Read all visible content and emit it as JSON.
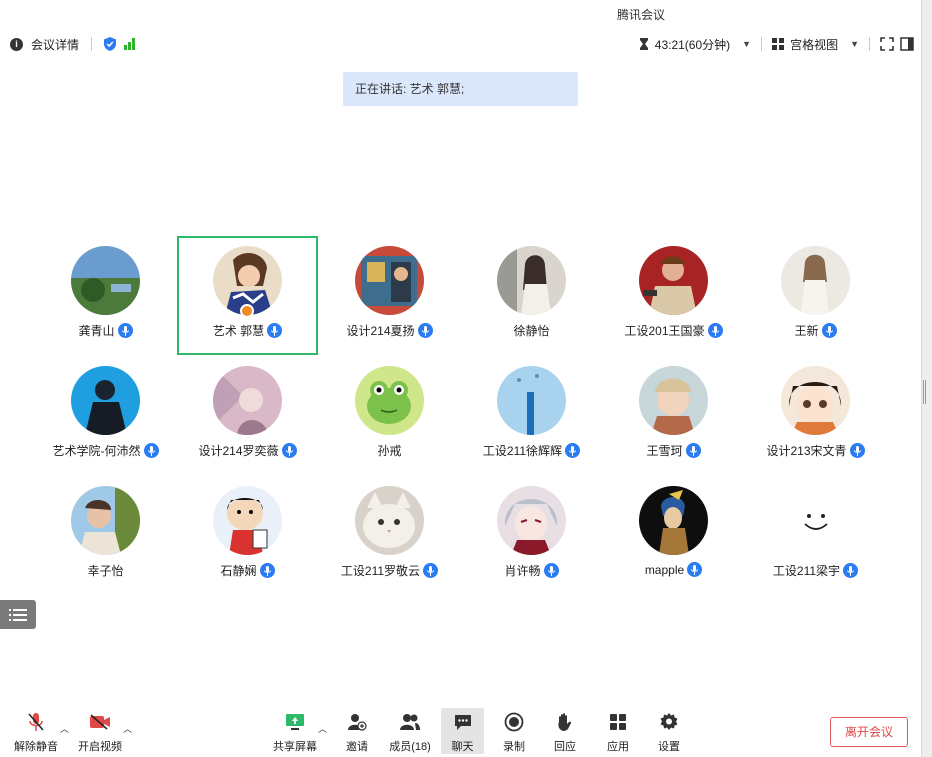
{
  "window": {
    "title": "腾讯会议"
  },
  "toolbar": {
    "meeting_info_label": "会议详情",
    "timer": "43:21(60分钟)",
    "view_label": "宫格视图"
  },
  "speaking": {
    "text": "正在讲话: 艺术 郭慧;"
  },
  "participants": [
    {
      "name": "龚青山",
      "mic": true,
      "active": false,
      "host": false
    },
    {
      "name": "艺术 郭慧",
      "mic": true,
      "active": true,
      "host": true
    },
    {
      "name": "设计214夏扬",
      "mic": true,
      "active": false,
      "host": false
    },
    {
      "name": "徐静怡",
      "mic": false,
      "active": false,
      "host": false
    },
    {
      "name": "工设201王国豪",
      "mic": true,
      "active": false,
      "host": false
    },
    {
      "name": "王新",
      "mic": true,
      "active": false,
      "host": false
    },
    {
      "name": "艺术学院-何沛然",
      "mic": true,
      "active": false,
      "host": false
    },
    {
      "name": "设计214罗奕薇",
      "mic": true,
      "active": false,
      "host": false
    },
    {
      "name": "孙戒",
      "mic": false,
      "active": false,
      "host": false
    },
    {
      "name": "工设211徐辉辉",
      "mic": true,
      "active": false,
      "host": false
    },
    {
      "name": "王雪珂",
      "mic": true,
      "active": false,
      "host": false
    },
    {
      "name": "设计213宋文青",
      "mic": true,
      "active": false,
      "host": false
    },
    {
      "name": "幸子怡",
      "mic": false,
      "active": false,
      "host": false
    },
    {
      "name": "石静娴",
      "mic": true,
      "active": false,
      "host": false
    },
    {
      "name": "工设211罗敬云",
      "mic": true,
      "active": false,
      "host": false
    },
    {
      "name": "肖许畅",
      "mic": true,
      "active": false,
      "host": false
    },
    {
      "name": "mapple",
      "mic": true,
      "active": false,
      "host": false
    },
    {
      "name": "工设211梁宇",
      "mic": true,
      "active": false,
      "host": false
    }
  ],
  "bottombar": {
    "unmute": "解除静音",
    "start_video": "开启视频",
    "share_screen": "共享屏幕",
    "invite": "邀请",
    "members": "成员(18)",
    "chat": "聊天",
    "record": "录制",
    "replay": "回应",
    "apps": "应用",
    "settings": "设置",
    "leave": "离开会议"
  },
  "colors": {
    "active_border": "#2eb86a",
    "mic_badge": "#2b7cf3",
    "speaking_bg": "#dbe8fb",
    "leave": "#e04848"
  }
}
